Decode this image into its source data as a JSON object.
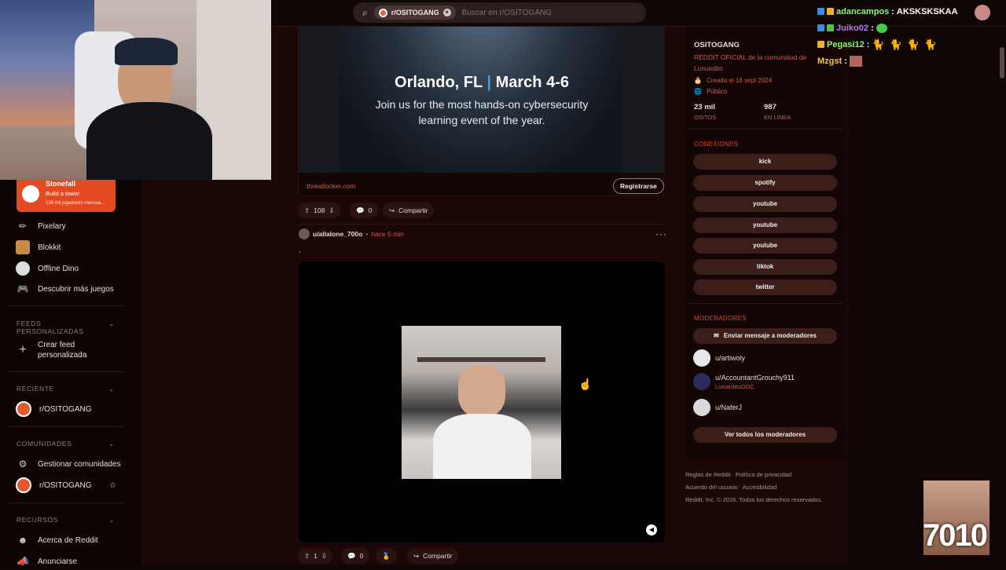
{
  "topbar": {
    "community_chip": "r/OSITOGANG",
    "search_placeholder": "Buscar en r/OSITOGANG"
  },
  "sidebar": {
    "game_card": {
      "title": "Stonefall",
      "subtitle": "Build a tower",
      "players": "136 mil jugadores mensua..."
    },
    "games": [
      "Pixelary",
      "Blokkit",
      "Offline Dino",
      "Descubrir más juegos"
    ],
    "feeds_header": "FEEDS PERSONALIZADAS",
    "create_feed": "Crear feed personalizada",
    "recent_header": "RECIENTE",
    "recent": [
      "r/OSITOGANG"
    ],
    "communities_header": "COMUNIDADES",
    "manage_communities": "Gestionar comunidades",
    "communities": [
      "r/OSITOGANG"
    ],
    "resources_header": "RECURSOS",
    "resources": [
      "Acerca de Reddit",
      "Anunciarse"
    ]
  },
  "ad": {
    "location": "Orlando, FL",
    "date": "March 4-6",
    "tagline": "Join us for the most hands-on cybersecurity learning event of the year.",
    "domain": "threatlocker.com",
    "cta": "Registrarse",
    "votes": "108",
    "comments": "0",
    "share": "Compartir"
  },
  "post": {
    "author": "u/allalone_700o",
    "time": "hace 5 min",
    "body": ".",
    "votes": "1",
    "comments": "0",
    "share": "Compartir"
  },
  "community": {
    "name": "OSITOGANG",
    "description": "REDDIT OFICIAL de la comunidad de Luisardito",
    "created": "Creada el 16 sept 2024",
    "visibility": "Público",
    "members_value": "23 mil",
    "members_label": "OSITOS",
    "online_value": "987",
    "online_label": "EN LÍNEA",
    "connections_header": "CONEXIONES",
    "connections": [
      "kick",
      "spotify",
      "youtube",
      "youtube",
      "youtube",
      "tiktok",
      "twitter"
    ],
    "moderators_header": "MODERADORES",
    "message_mods": "Enviar mensaje a moderadores",
    "moderators": [
      {
        "name": "u/artiwoly",
        "flair": ""
      },
      {
        "name": "u/AccountantGrouchy911",
        "flair": "LuisarditoOOC"
      },
      {
        "name": "u/NaferJ",
        "flair": ""
      }
    ],
    "view_all_mods": "Ver todos los moderadores"
  },
  "footer": {
    "rules": "Reglas de Reddit",
    "privacy": "Política de privacidad",
    "user_agreement": "Acuerdo del usuario",
    "accessibility": "Accesibilidad",
    "copyright": "Reddit, Inc. © 2026. Todos los derechos reservados."
  },
  "chat": [
    {
      "user": "adancampos",
      "message": "AKSKSKSKAA",
      "color": "#8ef57a"
    },
    {
      "user": "Juiko02",
      "message": "",
      "color": "#b07cf5"
    },
    {
      "user": "Pegasi12",
      "message": "",
      "color": "#8ef57a"
    },
    {
      "user": "Mzgst",
      "message": "",
      "color": "#f5c84a"
    }
  ],
  "overlay_text": "7010"
}
